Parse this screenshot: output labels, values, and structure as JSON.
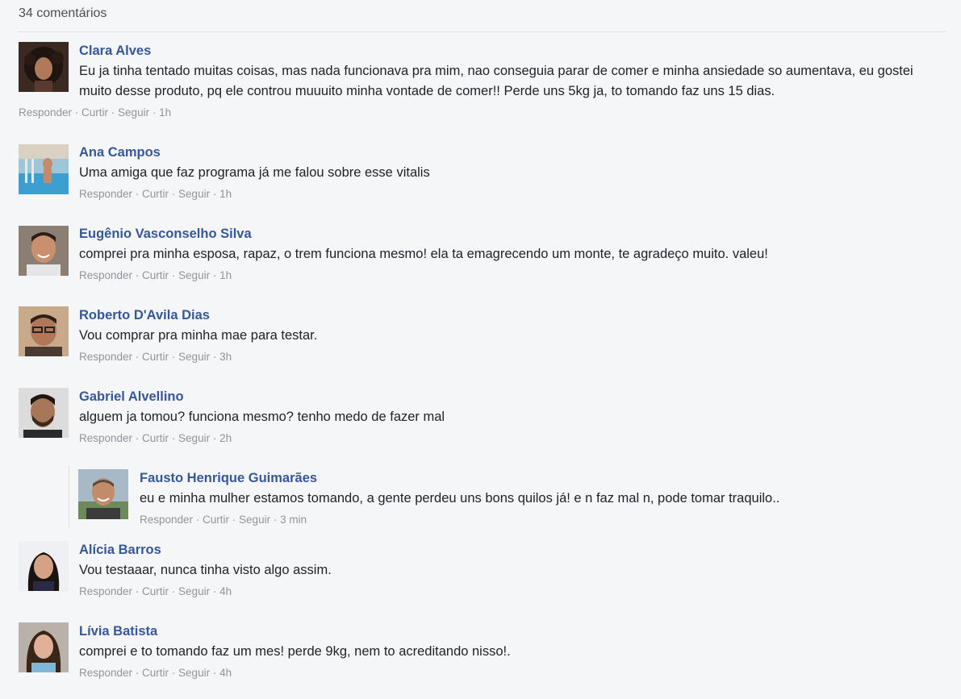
{
  "header": {
    "count_label": "34 comentários"
  },
  "actions": {
    "reply": "Responder",
    "like": "Curtir",
    "follow": "Seguir",
    "sep": " · "
  },
  "comments": [
    {
      "author": "Clara Alves",
      "text": "Eu ja tinha tentado muitas coisas, mas nada funcionava pra mim, nao conseguia parar de comer e minha ansiedade so aumentava, eu gostei muito desse produto, pq ele controu muuuito minha vontade de comer!! Perde uns 5kg ja, to tomando faz uns 15 dias.",
      "time": "1h",
      "avatar": "woman-curly-hair-avatar"
    },
    {
      "author": "Ana Campos",
      "text": "Uma amiga que faz programa já me falou sobre esse vitalis",
      "time": "1h",
      "avatar": "woman-pool-avatar"
    },
    {
      "author": "Eugênio Vasconselho Silva",
      "text": "comprei pra minha esposa, rapaz, o trem funciona mesmo! ela ta emagrecendo um monte, te agradeço muito. valeu!",
      "time": "1h",
      "avatar": "man-smiling-avatar"
    },
    {
      "author": "Roberto D'Avila Dias",
      "text": "Vou comprar pra minha mae para testar.",
      "time": "3h",
      "avatar": "man-glasses-avatar"
    },
    {
      "author": "Gabriel Alvellino",
      "text": "alguem ja tomou? funciona mesmo? tenho medo de fazer mal",
      "time": "2h",
      "avatar": "man-beard-avatar"
    },
    {
      "author": "Fausto Henrique Guimarães",
      "text": "eu e minha mulher estamos tomando, a gente perdeu uns bons quilos já! e n faz mal n, pode tomar traquilo..",
      "time": "3 min",
      "avatar": "man-bald-avatar"
    },
    {
      "author": "Alícia Barros",
      "text": "Vou testaaar, nunca tinha visto algo assim.",
      "time": "4h",
      "avatar": "woman-dark-hair-avatar"
    },
    {
      "author": "Lívia Batista",
      "text": "comprei e to tomando faz um mes! perde 9kg, nem to acreditando nisso!.",
      "time": "4h",
      "avatar": "woman-long-hair-avatar"
    }
  ]
}
